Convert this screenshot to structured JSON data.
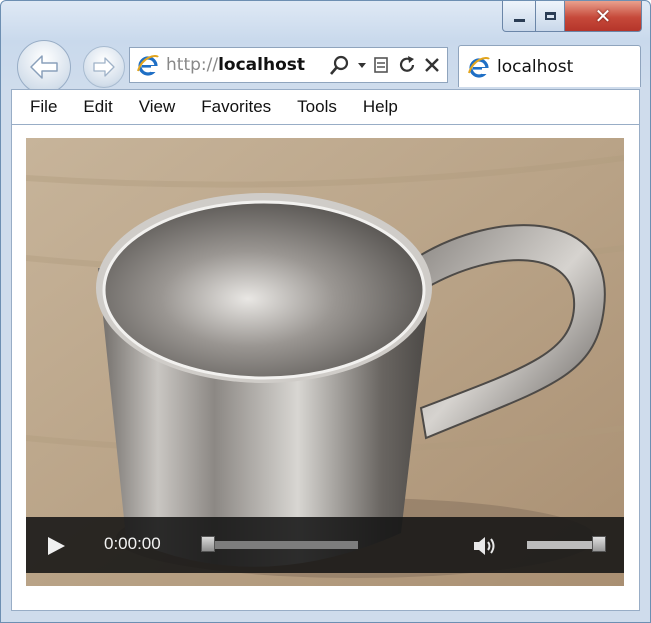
{
  "window": {
    "buttons": {
      "minimize_icon": "minimize-icon",
      "maximize_icon": "maximize-icon",
      "close_icon": "close-icon",
      "close_glyph": "✕"
    }
  },
  "nav": {
    "back_icon": "back-arrow-icon",
    "forward_icon": "forward-arrow-icon"
  },
  "address_bar": {
    "scheme": "http://",
    "host": "localhost",
    "site_icon": "ie-icon",
    "tools": [
      "search-icon",
      "dropdown-icon",
      "compat-view-icon",
      "refresh-icon",
      "stop-icon"
    ]
  },
  "tab": {
    "label": "localhost",
    "icon": "ie-icon"
  },
  "menu": {
    "items": [
      "File",
      "Edit",
      "View",
      "Favorites",
      "Tools",
      "Help"
    ]
  },
  "video_player": {
    "time": "0:00:00",
    "progress": 0,
    "volume": 0.95,
    "play_icon": "play-icon",
    "volume_icon": "speaker-icon"
  },
  "colors": {
    "ie_blue": "#1f6fc5",
    "close_red": "#c6493a",
    "controls_bg": "#141414"
  }
}
